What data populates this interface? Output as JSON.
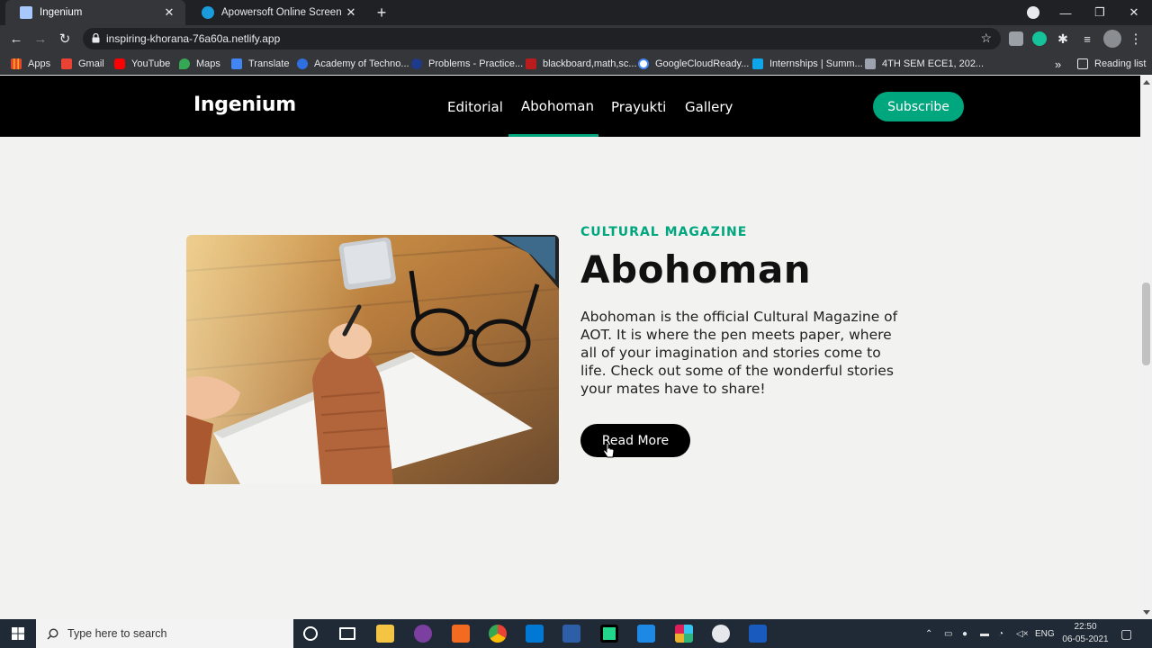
{
  "browser": {
    "tabs": [
      {
        "title": "Ingenium",
        "active": true
      },
      {
        "title": "Apowersoft Online Screen Recor",
        "active": false
      }
    ],
    "url": "inspiring-khorana-76a60a.netlify.app",
    "bookmarks": [
      {
        "label": "Apps",
        "icon": "apps-grid-icon",
        "color": "#e8eaed"
      },
      {
        "label": "Gmail",
        "icon": "gmail-icon",
        "color": "#ea4335"
      },
      {
        "label": "YouTube",
        "icon": "youtube-icon",
        "color": "#ff0000"
      },
      {
        "label": "Maps",
        "icon": "maps-pin-icon",
        "color": "#34a853"
      },
      {
        "label": "Translate",
        "icon": "translate-icon",
        "color": "#4285f4"
      },
      {
        "label": "Academy of Techno...",
        "icon": "academy-icon",
        "color": "#2f6fe0"
      },
      {
        "label": "Problems - Practice...",
        "icon": "practice-icon",
        "color": "#1e3a8a"
      },
      {
        "label": "blackboard,math,sc...",
        "icon": "blackboard-icon",
        "color": "#b91c1c"
      },
      {
        "label": "GoogleCloudReady...",
        "icon": "google-icon",
        "color": "#ffffff"
      },
      {
        "label": "Internships | Summ...",
        "icon": "internshala-icon",
        "color": "#0ea5e9"
      },
      {
        "label": "4TH SEM ECE1, 202...",
        "icon": "classroom-icon",
        "color": "#9ca3af"
      }
    ],
    "overflow_label": "»",
    "reading_list": "Reading list"
  },
  "site": {
    "brand": "Ingenium",
    "nav": [
      "Editorial",
      "Abohoman",
      "Prayukti",
      "Gallery"
    ],
    "active_nav": "Abohoman",
    "subscribe": "Subscribe",
    "accent": "#00a67e"
  },
  "feature": {
    "eyebrow": "CULTURAL MAGAZINE",
    "title": "Abohoman",
    "description": "Abohoman is the official Cultural Magazine of AOT. It is where the pen meets paper, where all of your imagination and stories come to life. Check out some of the wonderful stories your mates have to share!",
    "button": "Read More"
  },
  "taskbar": {
    "search_placeholder": "Type here to search",
    "language": "ENG",
    "time": "22:50",
    "date": "06-05-2021"
  }
}
